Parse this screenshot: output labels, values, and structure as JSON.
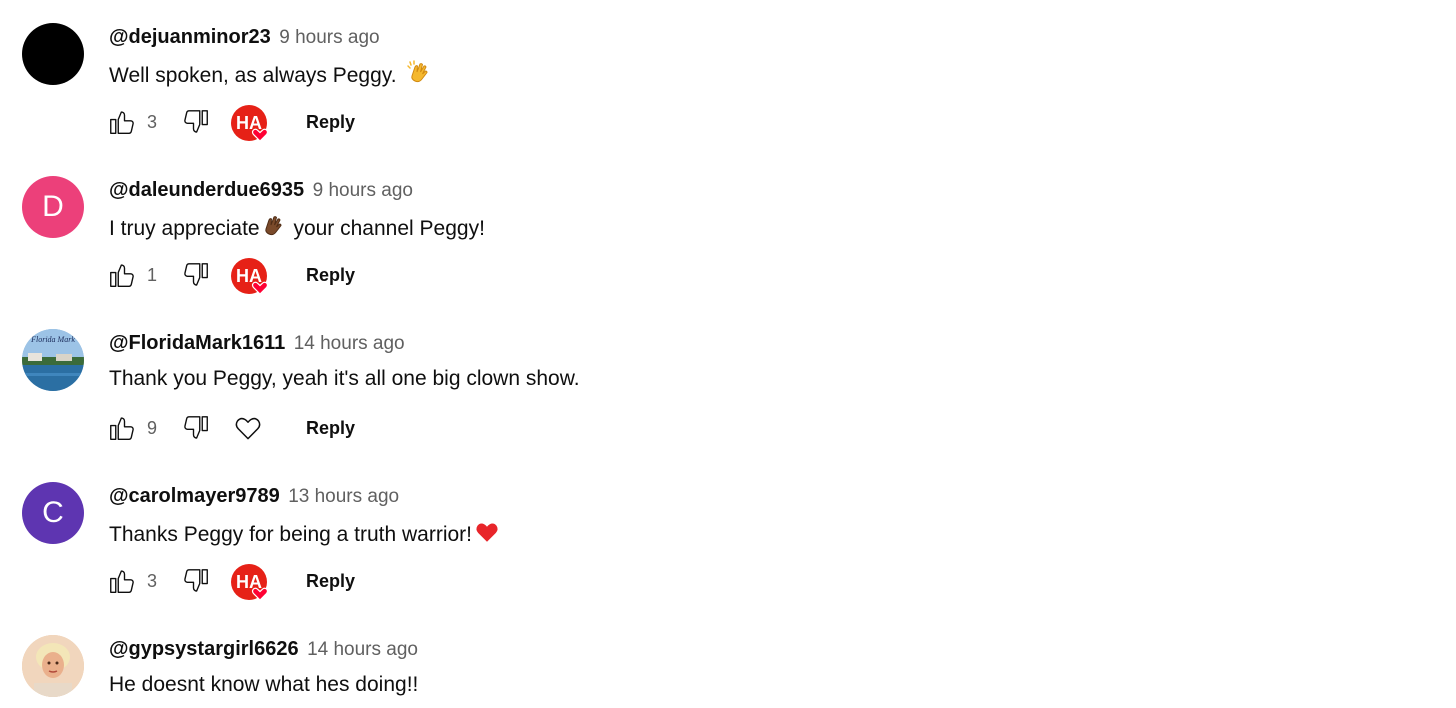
{
  "comments": [
    {
      "author": "@dejuanminor23",
      "time": "9 hours ago",
      "text": "Well spoken, as always Peggy.",
      "emoji": "clapping-hands",
      "likes": "3",
      "avatar": {
        "type": "solid",
        "color": "#000000",
        "letter": ""
      },
      "creator_heart": true,
      "creator_badge_text": "HA",
      "reply_label": "Reply"
    },
    {
      "author": "@daleunderdue6935",
      "time": "9 hours ago",
      "text_before": "I truy appreciate",
      "text_after": "your channel Peggy!",
      "emoji": "clapping-hands-dark",
      "likes": "1",
      "avatar": {
        "type": "letter",
        "color": "#ec407a",
        "letter": "D"
      },
      "creator_heart": true,
      "creator_badge_text": "HA",
      "reply_label": "Reply"
    },
    {
      "author": "@FloridaMark1611",
      "time": "14 hours ago",
      "text": "Thank you Peggy, yeah it's all one big clown show.",
      "likes": "9",
      "avatar": {
        "type": "photo",
        "caption": "Florida Mark"
      },
      "creator_heart": false,
      "reply_label": "Reply"
    },
    {
      "author": "@carolmayer9789",
      "time": "13 hours ago",
      "text": "Thanks Peggy for being a truth warrior!",
      "emoji": "red-heart",
      "likes": "3",
      "avatar": {
        "type": "letter",
        "color": "#5e35b1",
        "letter": "C"
      },
      "creator_heart": true,
      "creator_badge_text": "HA",
      "reply_label": "Reply"
    },
    {
      "author": "@gypsystargirl6626",
      "time": "14 hours ago",
      "text": "He doesnt know what hes doing!!",
      "avatar": {
        "type": "photo"
      }
    }
  ],
  "colors": {
    "author": "#0f0f0f",
    "meta": "#606060",
    "badge_red": "#e62117"
  }
}
